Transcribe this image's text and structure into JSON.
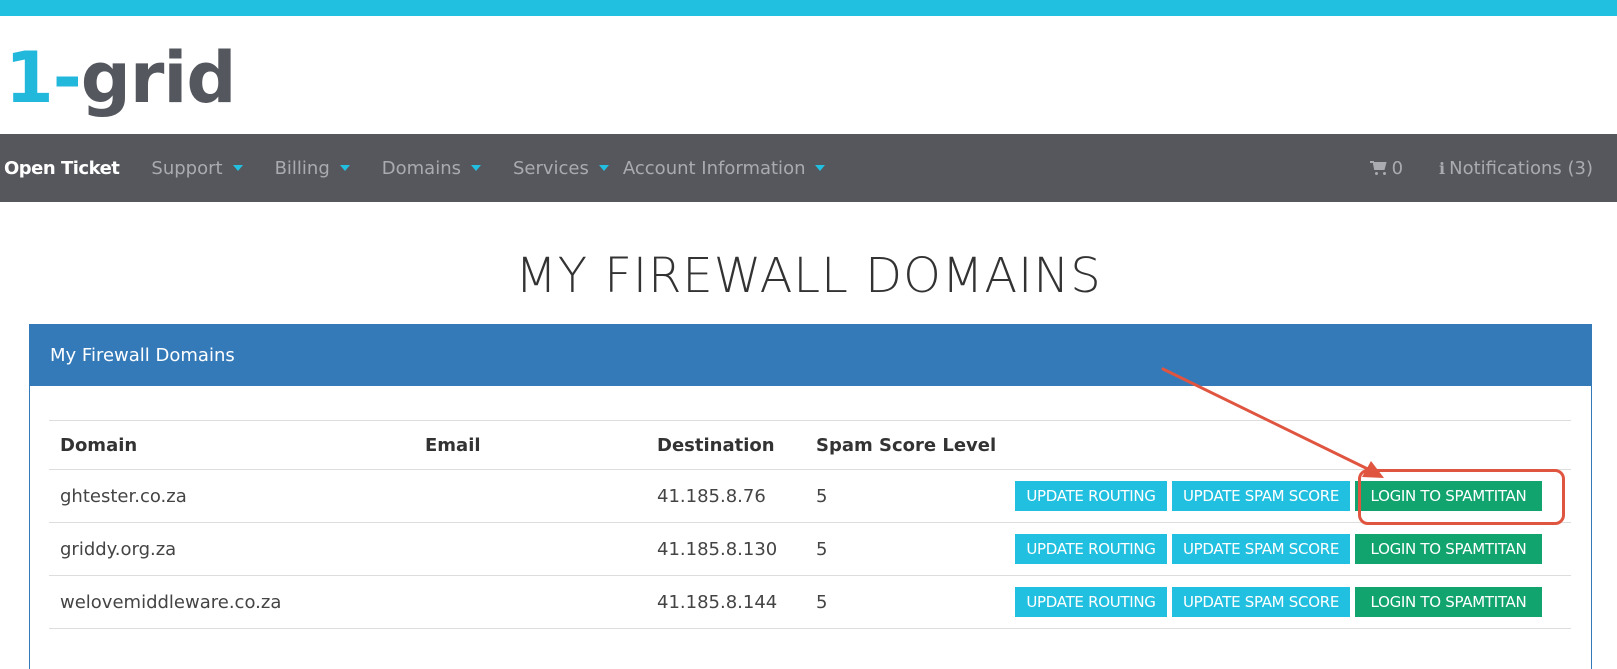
{
  "logo": {
    "one": "1-",
    "grid": "grid"
  },
  "nav": {
    "items": [
      {
        "label": "Open Ticket",
        "caret": false
      },
      {
        "label": "Support",
        "caret": true
      },
      {
        "label": "Billing",
        "caret": true
      },
      {
        "label": "Domains",
        "caret": true
      },
      {
        "label": "Services",
        "caret": true
      },
      {
        "label": "Account Information",
        "caret": true
      }
    ],
    "cart_count": "0",
    "notifications": "Notifications (3)"
  },
  "page_title": "MY FIREWALL DOMAINS",
  "panel": {
    "title": "My Firewall Domains",
    "columns": [
      "Domain",
      "Email",
      "Destination",
      "Spam Score Level"
    ],
    "rows": [
      {
        "domain": "ghtester.co.za",
        "email": "",
        "destination": "41.185.8.76",
        "spam_score": "5"
      },
      {
        "domain": "griddy.org.za",
        "email": "",
        "destination": "41.185.8.130",
        "spam_score": "5"
      },
      {
        "domain": "welovemiddleware.co.za",
        "email": "",
        "destination": "41.185.8.144",
        "spam_score": "5"
      }
    ],
    "actions": {
      "update_routing": "UPDATE ROUTING",
      "update_spam_score": "UPDATE SPAM SCORE",
      "login_spamtitan": "LOGIN TO SPAMTITAN"
    }
  },
  "colors": {
    "top_stripe": "#22c0e0",
    "navbar": "#56575d",
    "panel_header": "#357ab8",
    "btn_info": "#22c0e0",
    "btn_success": "#11a46f",
    "annotation": "#e05540"
  }
}
